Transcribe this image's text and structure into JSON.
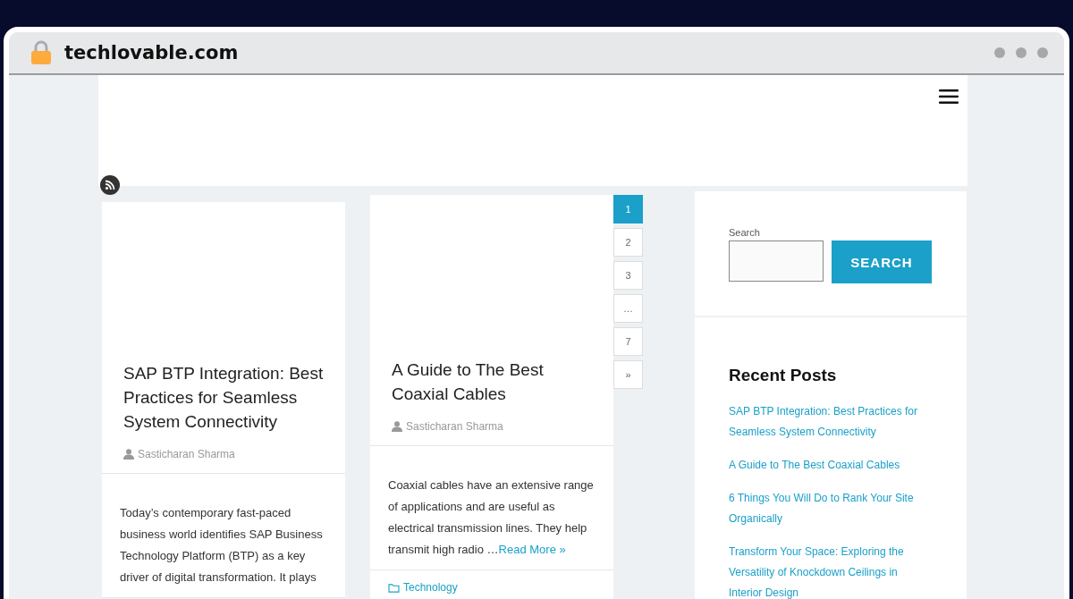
{
  "browser": {
    "address": "techlovable.com"
  },
  "posts": [
    {
      "title": "SAP BTP Integration: Best Practices for Seamless System Connectivity",
      "author": "Sasticharan Sharma",
      "excerpt": "Today’s contemporary fast-paced business world identifies SAP Business Technology Platform (BTP) as a key driver of digital transformation. It plays"
    },
    {
      "title": "A Guide to The Best Coaxial Cables",
      "author": "Sasticharan Sharma",
      "excerpt": "Coaxial cables have an extensive range of applications and are useful as electrical transmission lines. They help transmit high radio …",
      "read_more": "Read More »",
      "category": "Technology"
    }
  ],
  "pagination": [
    {
      "label": "1",
      "selected": true
    },
    {
      "label": "2",
      "selected": false
    },
    {
      "label": "3",
      "selected": false
    },
    {
      "label": "…",
      "selected": false
    },
    {
      "label": "7",
      "selected": false
    },
    {
      "label": "»",
      "selected": false
    }
  ],
  "sidebar": {
    "search": {
      "label": "Search",
      "button": "SEARCH"
    },
    "recent_posts": {
      "title": "Recent Posts",
      "items": [
        "SAP BTP Integration: Best Practices for Seamless System Connectivity",
        "A Guide to The Best Coaxial Cables",
        "6 Things You Will Do to Rank Your Site Organically",
        "Transform Your Space: Exploring the Versatility of Knockdown Ceilings in Interior Design"
      ]
    }
  }
}
